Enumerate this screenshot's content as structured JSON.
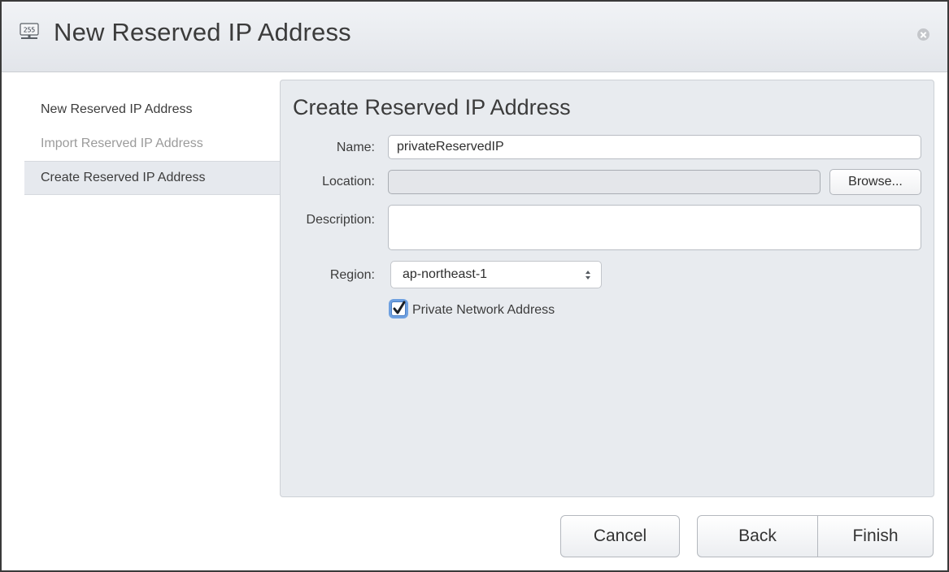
{
  "dialog": {
    "title": "New Reserved IP Address",
    "title_icon": "ip-address-icon",
    "close_icon": "close-icon"
  },
  "wizard_steps": [
    {
      "label": "New Reserved IP Address",
      "state": "normal"
    },
    {
      "label": "Import Reserved IP Address",
      "state": "disabled"
    },
    {
      "label": "Create Reserved IP Address",
      "state": "selected"
    }
  ],
  "form": {
    "title": "Create Reserved IP Address",
    "name_label": "Name:",
    "name_value": "privateReservedIP",
    "location_label": "Location:",
    "location_value": "",
    "browse_label": "Browse...",
    "description_label": "Description:",
    "description_value": "",
    "region_label": "Region:",
    "region_value": "ap-northeast-1",
    "private_network_label": "Private Network Address",
    "private_network_checked": true
  },
  "footer": {
    "cancel_label": "Cancel",
    "back_label": "Back",
    "finish_label": "Finish"
  },
  "colors": {
    "panel_bg": "#e8ebef",
    "selected_step_bg": "#e6e9ee",
    "focus_ring": "#6ea0e0"
  }
}
